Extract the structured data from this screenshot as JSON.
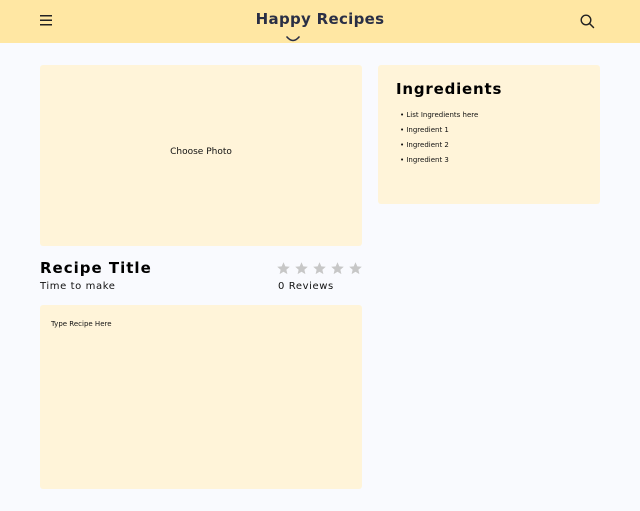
{
  "header": {
    "brand": "Happy Recipes",
    "menu_icon": "hamburger-menu-icon",
    "search_icon": "search-icon",
    "background": "#ffe7a3"
  },
  "photo": {
    "label": "Choose Photo"
  },
  "recipe": {
    "title": "Recipe Title",
    "time_label": "Time to make",
    "rating": {
      "value": 0,
      "max": 5
    },
    "reviews_label": "0 Reviews",
    "body_placeholder": "Type Recipe Here"
  },
  "ingredients": {
    "heading": "Ingredients",
    "items": [
      "List Ingredients here",
      "Ingredient 1",
      "Ingredient 2",
      "Ingredient 3"
    ]
  },
  "colors": {
    "card": "#fff4d9",
    "page": "#f9fafe",
    "star_empty": "#c7c7c7"
  }
}
